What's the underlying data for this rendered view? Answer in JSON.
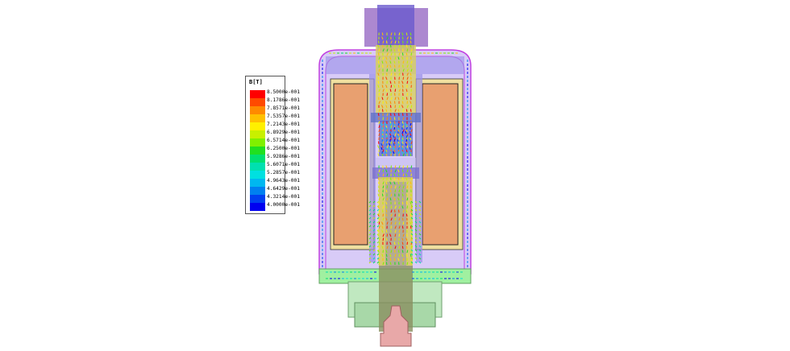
{
  "legend": {
    "title": "B[T]",
    "entries": [
      {
        "label": "8.5000e-001",
        "color": "#ff0000"
      },
      {
        "label": "8.1786e-001",
        "color": "#ff4a00"
      },
      {
        "label": "7.8571e-001",
        "color": "#ff8a00"
      },
      {
        "label": "7.5357e-001",
        "color": "#ffc000"
      },
      {
        "label": "7.2143e-001",
        "color": "#fff000"
      },
      {
        "label": "6.8929e-001",
        "color": "#c8f000"
      },
      {
        "label": "6.5714e-001",
        "color": "#80f000"
      },
      {
        "label": "6.2500e-001",
        "color": "#20e020"
      },
      {
        "label": "5.9286e-001",
        "color": "#00e070"
      },
      {
        "label": "5.6071e-001",
        "color": "#00e0b0"
      },
      {
        "label": "5.2857e-001",
        "color": "#00e0e0"
      },
      {
        "label": "4.9643e-001",
        "color": "#00b8f0"
      },
      {
        "label": "4.6429e-001",
        "color": "#0080f0"
      },
      {
        "label": "4.3214e-001",
        "color": "#0040f0"
      },
      {
        "label": "4.0000e-001",
        "color": "#0000f0"
      }
    ]
  },
  "part_colors": {
    "housing": "#b8a0f0",
    "housing_edge": "#c040e0",
    "coil": "#e8a070",
    "bobbin": "#f0e0a0",
    "top_cap": "#9060c0",
    "base_plate": "#a0f0a0",
    "base_body": "#c0e8c0",
    "tip": "#e8a8a8",
    "plunger_core": "#8080c0"
  }
}
